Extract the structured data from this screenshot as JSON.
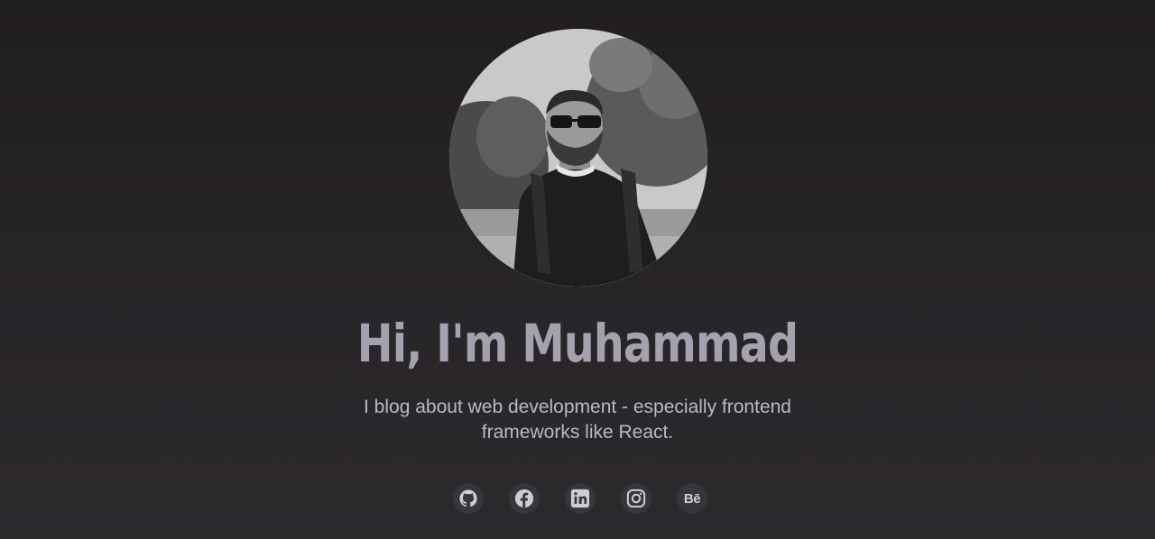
{
  "hero": {
    "title": "Hi, I'm Muhammad",
    "tagline": "I blog about web development - especially frontend frameworks like React."
  },
  "avatar": {
    "icon": "profile-photo",
    "style": "greyscale"
  },
  "socials": [
    {
      "icon": "github-icon",
      "label": ""
    },
    {
      "icon": "facebook-icon",
      "label": ""
    },
    {
      "icon": "linkedin-icon",
      "label": ""
    },
    {
      "icon": "instagram-icon",
      "label": ""
    },
    {
      "icon": "behance-icon",
      "label": "Bē"
    }
  ],
  "colors": {
    "background": "#262327",
    "title": "#a6a1ae",
    "tagline": "#bcb7c2",
    "icon_bg": "#39363b",
    "icon_fg": "#d0ccd4"
  }
}
